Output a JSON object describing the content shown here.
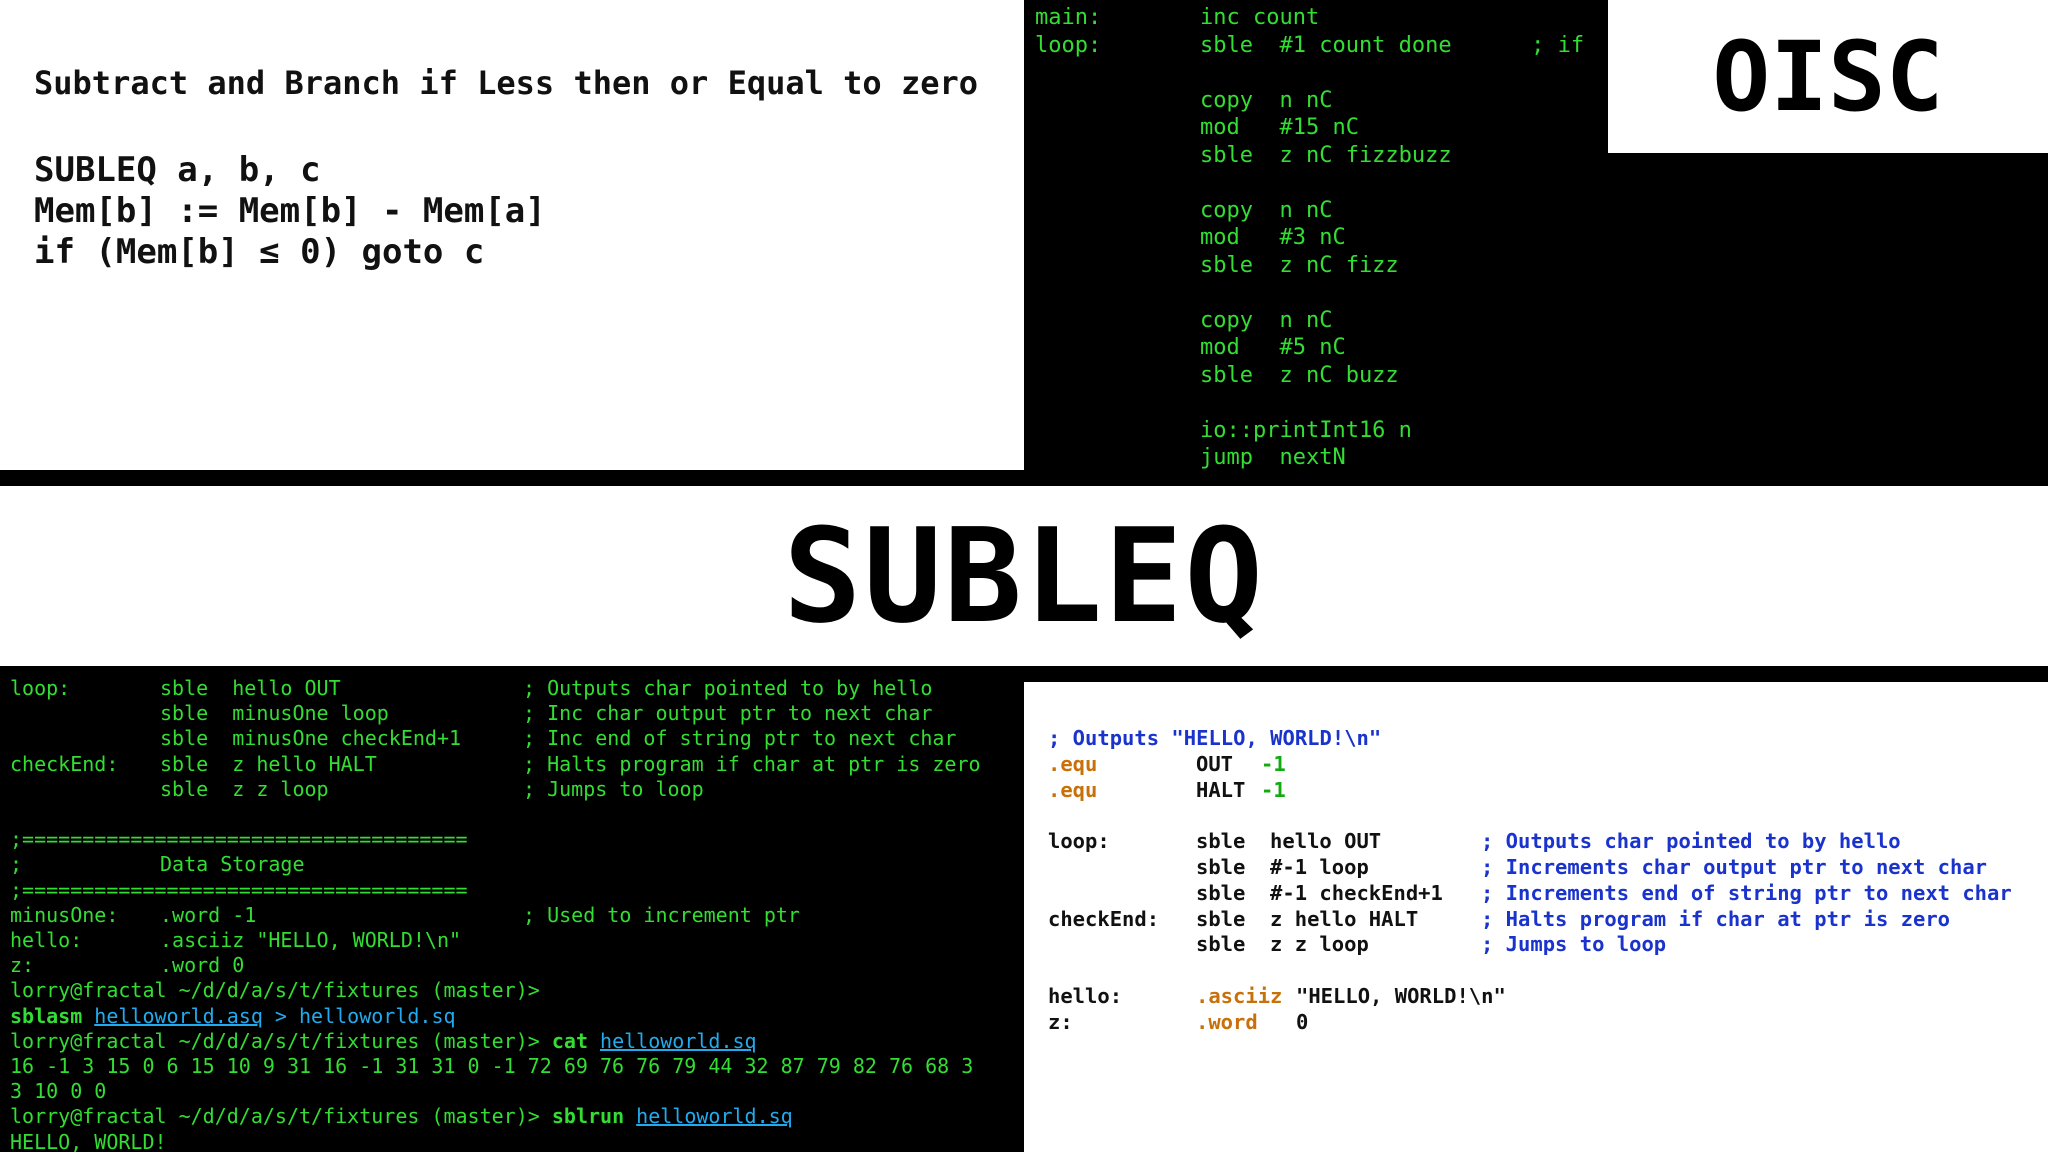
{
  "definition": {
    "title": "Subtract and Branch if Less then or Equal to zero",
    "lines": [
      "SUBLEQ a, b, c",
      "Mem[b] := Mem[b] - Mem[a]",
      "if (Mem[b] ≤ 0) goto c"
    ]
  },
  "fizzbuzz": {
    "lines": [
      {
        "label": "main:",
        "code": "inc count"
      },
      {
        "label": "loop:",
        "code": "sble  #1 count done      ; if"
      },
      {
        "label": "",
        "code": ""
      },
      {
        "label": "",
        "code": "copy  n nC"
      },
      {
        "label": "",
        "code": "mod   #15 nC"
      },
      {
        "label": "",
        "code": "sble  z nC fizzbuzz"
      },
      {
        "label": "",
        "code": ""
      },
      {
        "label": "",
        "code": "copy  n nC"
      },
      {
        "label": "",
        "code": "mod   #3 nC"
      },
      {
        "label": "",
        "code": "sble  z nC fizz"
      },
      {
        "label": "",
        "code": ""
      },
      {
        "label": "",
        "code": "copy  n nC"
      },
      {
        "label": "",
        "code": "mod   #5 nC"
      },
      {
        "label": "",
        "code": "sble  z nC buzz"
      },
      {
        "label": "",
        "code": ""
      },
      {
        "label": "",
        "code": "io::printInt16 n"
      },
      {
        "label": "",
        "code": "jump  nextN"
      }
    ]
  },
  "badge": "OISC",
  "banner": "SUBLEQ",
  "terminal": {
    "code_lines": [
      {
        "label": "loop:",
        "code": "sble  hello OUT",
        "comment": "; Outputs char pointed to by hello"
      },
      {
        "label": "",
        "code": "sble  minusOne loop",
        "comment": "; Inc char output ptr to next char"
      },
      {
        "label": "",
        "code": "sble  minusOne checkEnd+1",
        "comment": "; Inc end of string ptr to next char"
      },
      {
        "label": "checkEnd:",
        "code": "sble  z hello HALT",
        "comment": "; Halts program if char at ptr is zero"
      },
      {
        "label": "",
        "code": "sble  z z loop",
        "comment": "; Jumps to loop"
      },
      {
        "label": "",
        "code": "",
        "comment": ""
      },
      {
        "label": ";=====================================",
        "code": "",
        "comment": ""
      },
      {
        "label": ";",
        "code": "Data Storage",
        "comment": ""
      },
      {
        "label": ";=====================================",
        "code": "",
        "comment": ""
      },
      {
        "label": "minusOne:",
        "code": ".word -1",
        "comment": "; Used to increment ptr"
      },
      {
        "label": "hello:",
        "code": ".asciiz \"HELLO, WORLD!\\n\"",
        "comment": ""
      },
      {
        "label": "z:",
        "code": ".word 0",
        "comment": ""
      }
    ],
    "prompt": "lorry@fractal ~/d/d/a/s/t/fixtures (master)>",
    "cmd1": {
      "name": "sblasm",
      "arg": "helloworld.asq",
      "sep": ">",
      "out": "helloworld.sq"
    },
    "cmd2": {
      "name": "cat",
      "arg": "helloworld.sq"
    },
    "output_lines": [
      "16 -1 3 15 0 6 15 10 9 31 16 -1 31 31 0 -1 72 69 76 76 79 44 32 87 79 82 76 68 3",
      "3 10 0 0"
    ],
    "cmd3": {
      "name": "sblrun",
      "arg": "helloworld.sq"
    },
    "result": "HELLO, WORLD!"
  },
  "hello_source": {
    "header": "; Outputs \"HELLO, WORLD!\\n\"",
    "equs": [
      {
        "directive": ".equ",
        "name": "OUT",
        "value": "-1"
      },
      {
        "directive": ".equ",
        "name": "HALT",
        "value": "-1"
      }
    ],
    "instr": [
      {
        "label": "loop:",
        "code": "sble  hello OUT",
        "comment": "; Outputs char pointed to by hello"
      },
      {
        "label": "",
        "code": "sble  #-1 loop",
        "comment": "; Increments char output ptr to next char"
      },
      {
        "label": "",
        "code": "sble  #-1 checkEnd+1",
        "comment": "; Increments end of string ptr to next char"
      },
      {
        "label": "checkEnd:",
        "code": "sble  z hello HALT",
        "comment": "; Halts program if char at ptr is zero"
      },
      {
        "label": "",
        "code": "sble  z z loop",
        "comment": "; Jumps to loop"
      }
    ],
    "data": [
      {
        "label": "hello:",
        "directive": ".asciiz",
        "value": "\"HELLO, WORLD!\\n\""
      },
      {
        "label": "z:",
        "directive": ".word",
        "value": "0"
      }
    ]
  }
}
